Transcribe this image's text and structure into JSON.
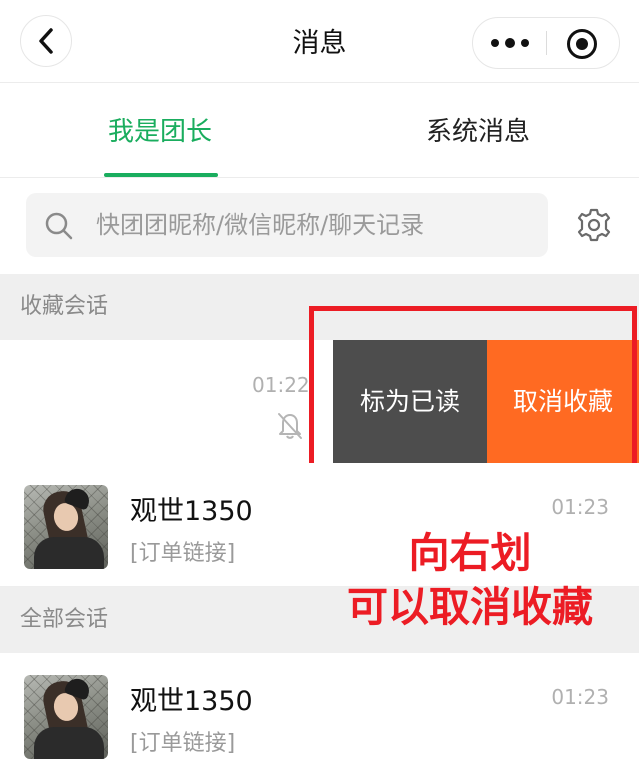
{
  "navbar": {
    "title": "消息"
  },
  "tabs": [
    {
      "label": "我是团长",
      "active": true
    },
    {
      "label": "系统消息",
      "active": false
    }
  ],
  "search": {
    "placeholder": "快团团昵称/微信昵称/聊天记录"
  },
  "sections": {
    "favorites": "收藏会话",
    "all": "全部会话"
  },
  "swiped_row": {
    "time": "01:22",
    "actions": {
      "mark_read": "标为已读",
      "unfavorite": "取消收藏"
    }
  },
  "favorite_conversations": [
    {
      "name": "观世1350",
      "preview": "[订单链接]",
      "time": "01:23"
    }
  ],
  "all_conversations": [
    {
      "name": "观世1350",
      "preview": "[订单链接]",
      "time": "01:23"
    }
  ],
  "annotation": {
    "line1": "向右划",
    "line2": "可以取消收藏"
  },
  "colors": {
    "accent": "#1aad5e",
    "unfavorite": "#ff6a22",
    "mark_read": "#4d4d4d",
    "annotation": "#ec1c24"
  }
}
